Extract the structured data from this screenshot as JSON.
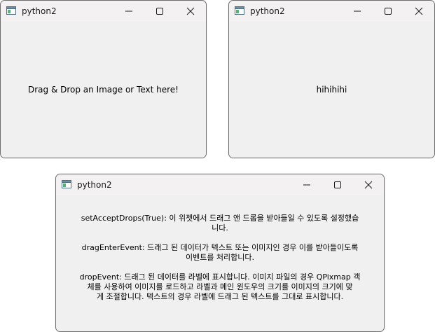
{
  "colors": {
    "window_bg": "#f0f0f0",
    "titlebar_bg": "#f4f1f3",
    "border": "#6d6d6d",
    "text": "#000000"
  },
  "windows": [
    {
      "title": "python2",
      "icon": "app-window-icon",
      "content_text": "Drag & Drop an Image or Text here!"
    },
    {
      "title": "python2",
      "icon": "app-window-icon",
      "content_text": "hihihihi"
    },
    {
      "title": "python2",
      "icon": "app-window-icon",
      "paragraphs": [
        {
          "line1": "setAcceptDrops(True): 이 위젯에서 드래그 앤 드롭을 받아들일 수 있도록 설정했습",
          "line2": "니다."
        },
        {
          "line1": "dragEnterEvent: 드래그 된 데이터가 텍스트 또는 이미지인 경우 이를 받아들이도록",
          "line2": "이벤트를 처리합니다."
        },
        {
          "line1": "dropEvent: 드래그 된 데이터를 라벨에 표시합니다. 이미지 파일의 경우 QPixmap 객",
          "line2": "체를 사용하여 이미지를 로드하고 라벨과 메인 윈도우의 크기를 이미지의 크기에 맞",
          "line3": "게 조절합니다. 텍스트의 경우 라벨에 드래그 된 텍스트를 그대로 표시합니다."
        }
      ]
    }
  ]
}
